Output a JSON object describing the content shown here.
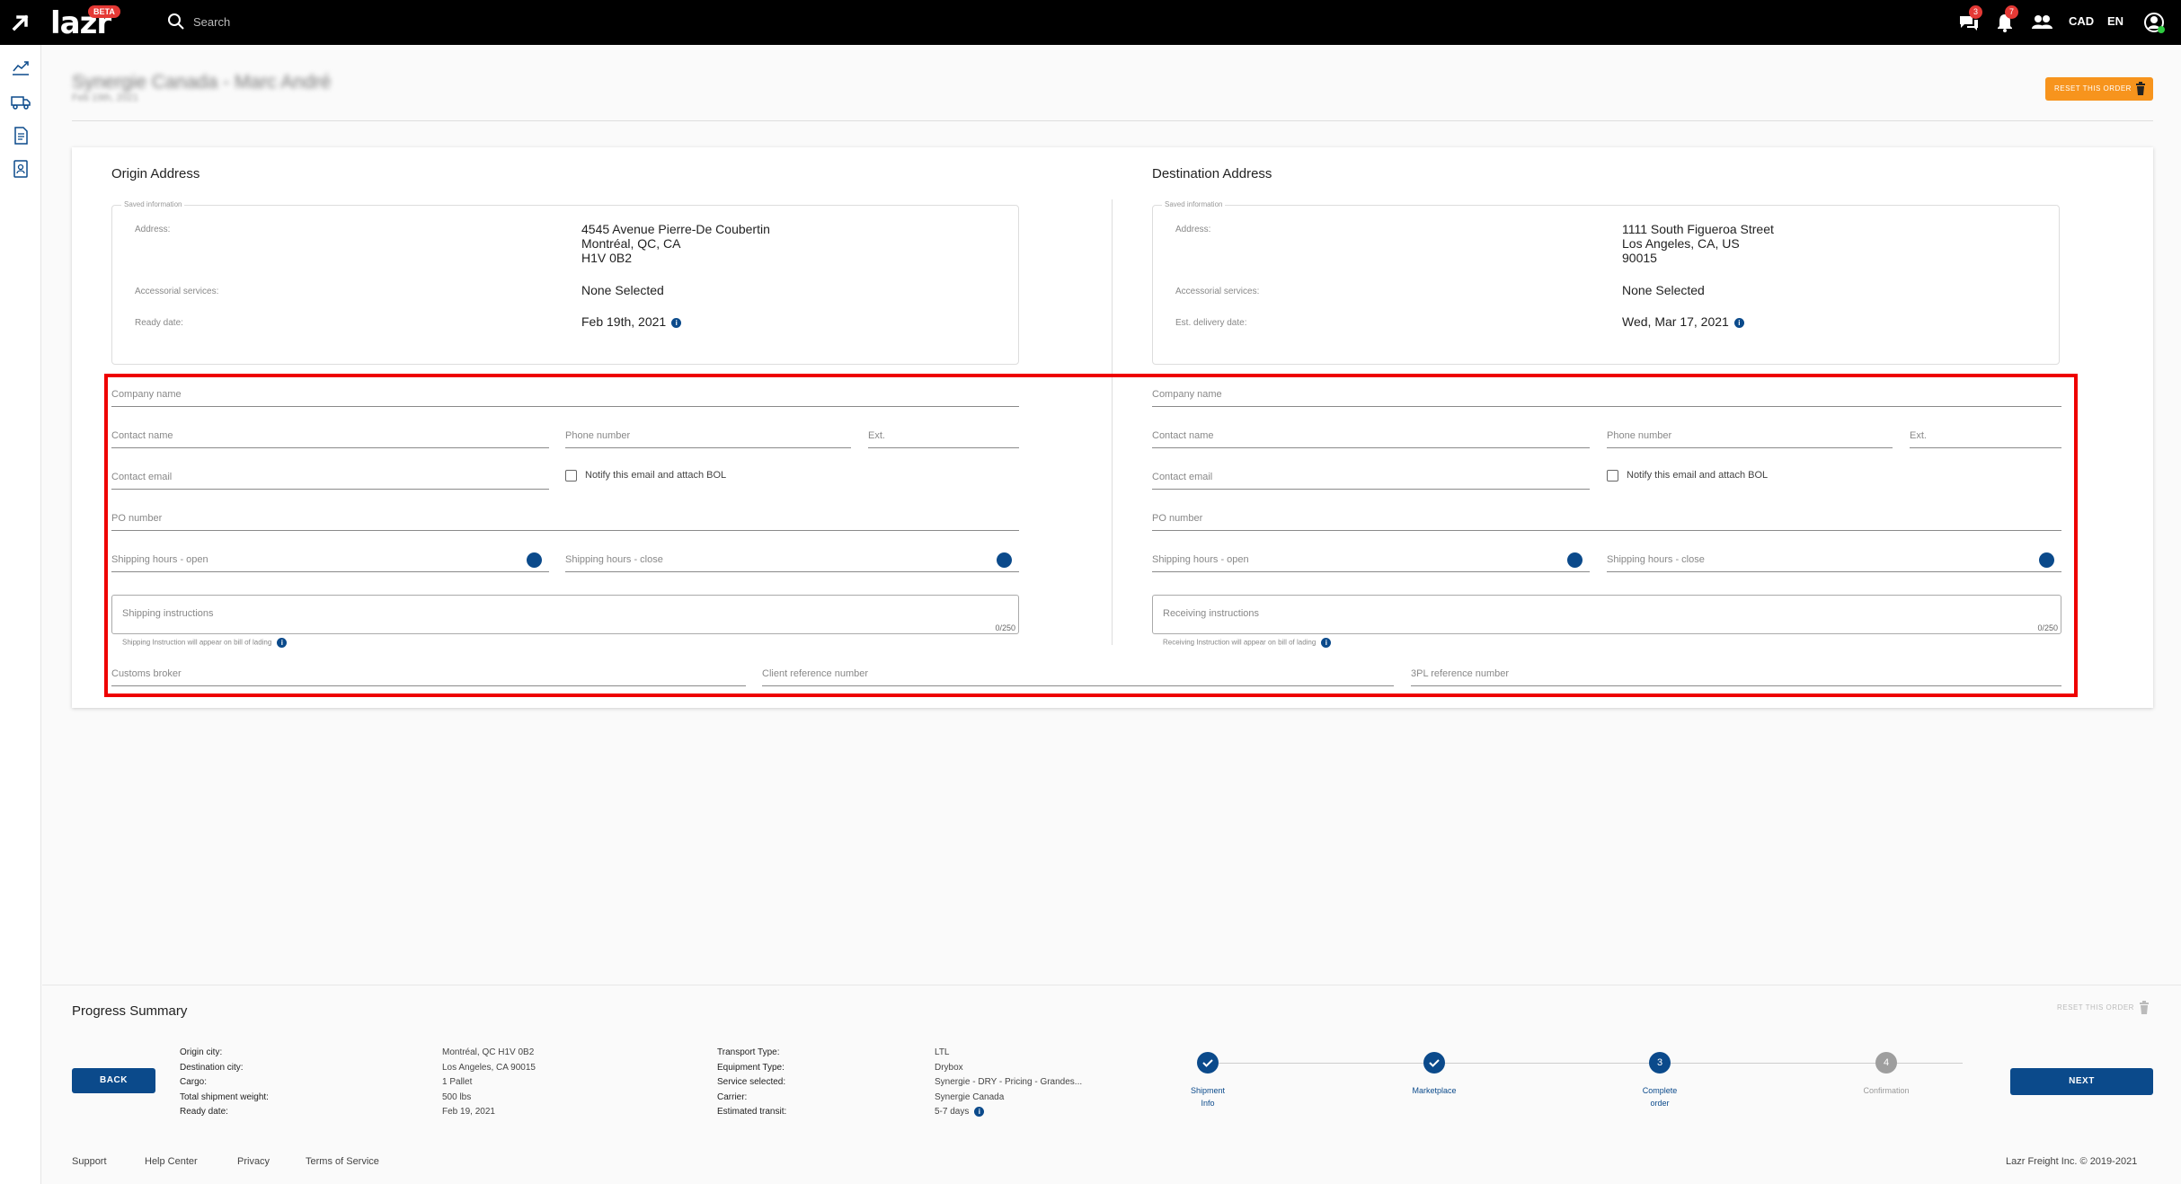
{
  "topbar": {
    "logo_text": "lazr",
    "beta": "BETA",
    "search_placeholder": "Search",
    "messages_count": "3",
    "notifications_count": "7",
    "currency": "CAD",
    "language": "EN"
  },
  "header": {
    "order_title": "Synergie Canada - Marc André",
    "order_subtitle": "Feb 19th, 2021",
    "reset_label": "RESET THIS ORDER"
  },
  "origin": {
    "title": "Origin Address",
    "saved_legend": "Saved information",
    "address_label": "Address:",
    "address_line1": "4545 Avenue Pierre-De Coubertin",
    "address_line2": "Montréal, QC, CA",
    "address_line3": "H1V 0B2",
    "accessorial_label": "Accessorial services:",
    "accessorial_value": "None Selected",
    "date_label": "Ready date:",
    "date_value": "Feb 19th, 2021",
    "form": {
      "company_name": "Company name",
      "contact_name": "Contact name",
      "phone_number": "Phone number",
      "ext": "Ext.",
      "contact_email": "Contact email",
      "notify_label": "Notify this email and attach BOL",
      "po_number": "PO number",
      "hours_open": "Shipping hours - open",
      "hours_close": "Shipping hours - close",
      "instructions": "Shipping instructions",
      "instructions_count": "0/250",
      "instructions_hint": "Shipping Instruction will appear on bill of lading"
    }
  },
  "destination": {
    "title": "Destination Address",
    "saved_legend": "Saved information",
    "address_label": "Address:",
    "address_line1": "1111 South Figueroa Street",
    "address_line2": "Los Angeles, CA, US",
    "address_line3": "90015",
    "accessorial_label": "Accessorial services:",
    "accessorial_value": "None Selected",
    "date_label": "Est. delivery date:",
    "date_value": "Wed, Mar 17, 2021",
    "form": {
      "company_name": "Company name",
      "contact_name": "Contact name",
      "phone_number": "Phone number",
      "ext": "Ext.",
      "contact_email": "Contact email",
      "notify_label": "Notify this email and attach BOL",
      "po_number": "PO number",
      "hours_open": "Shipping hours - open",
      "hours_close": "Shipping hours - close",
      "instructions": "Receiving instructions",
      "instructions_count": "0/250",
      "instructions_hint": "Receiving Instruction will appear on bill of lading"
    }
  },
  "shared_fields": {
    "customs_broker": "Customs broker",
    "client_reference": "Client reference number",
    "tpl_reference": "3PL reference number"
  },
  "summary": {
    "title": "Progress Summary",
    "reset_label": "RESET THIS ORDER",
    "back_label": "BACK",
    "next_label": "NEXT",
    "col1_labels": [
      "Origin city:",
      "Destination city:",
      "Cargo:",
      "Total shipment weight:",
      "Ready date:"
    ],
    "col1_values": [
      "Montréal, QC H1V 0B2",
      "Los Angeles, CA 90015",
      "1 Pallet",
      "500 lbs",
      "Feb 19, 2021"
    ],
    "col2_labels": [
      "Transport Type:",
      "Equipment Type:",
      "Service selected:",
      "Carrier:",
      "Estimated transit:"
    ],
    "col2_values": [
      "LTL",
      "Drybox",
      "Synergie - DRY - Pricing - Grandes...",
      "Synergie Canada",
      "5-7 days"
    ],
    "steps": [
      {
        "label_line1": "Shipment",
        "label_line2": "Info",
        "state": "done"
      },
      {
        "label_line1": "Marketplace",
        "label_line2": "",
        "state": "done"
      },
      {
        "label_line1": "Complete",
        "label_line2": "order",
        "state": "current",
        "number": "3"
      },
      {
        "label_line1": "Confirmation",
        "label_line2": "",
        "state": "todo",
        "number": "4"
      }
    ]
  },
  "footer": {
    "links": [
      "Support",
      "Help Center",
      "Privacy",
      "Terms of Service"
    ],
    "copyright": "Lazr Freight Inc. © 2019-2021"
  },
  "colors": {
    "primary": "#0b4a8b",
    "accent_orange": "#f7941d",
    "highlight_red": "#ee0000"
  }
}
